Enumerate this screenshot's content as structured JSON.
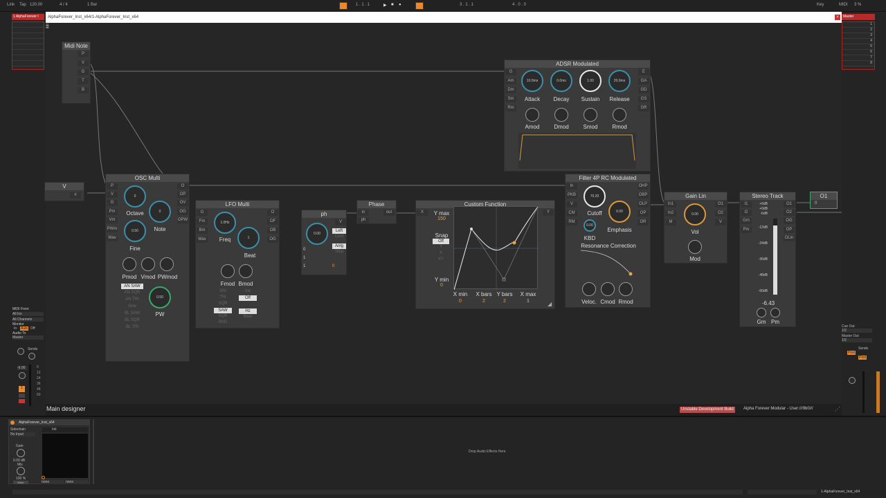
{
  "transport": {
    "link": "Link",
    "tap": "Tap",
    "tempo": "120.00",
    "signature": "4 / 4",
    "quantize": "1 Bar",
    "position": "1 . 1 . 1",
    "loop_start": "3 . 1 . 1",
    "loop_length": "4 . 0 . 0",
    "key": "Key",
    "midi": "MIDI",
    "cpu": "3 %"
  },
  "left_track": {
    "name": "1 AlphaForever I"
  },
  "right_track": {
    "name": "Master",
    "slots": [
      "1",
      "2",
      "3",
      "4",
      "5",
      "6",
      "7",
      "8"
    ]
  },
  "plugin_window": {
    "title": "AlphaForever_Inst_x64/1-AlphaForever_Inst_x64"
  },
  "modules": {
    "midi_note": {
      "title": "Midi Note",
      "outputs": [
        "P",
        "V",
        "G",
        "T",
        "B"
      ]
    },
    "v_module": {
      "title": "V",
      "out": "#"
    },
    "osc": {
      "title": "OSC Multi",
      "inputs": [
        "P",
        "V",
        "G",
        "Pm",
        "Vm",
        "PWm",
        "Wav"
      ],
      "outputs": [
        "O",
        "OP",
        "OV",
        "OG",
        "OPW"
      ],
      "octave_value": "0",
      "note_value": "0",
      "fine_value": "0.50",
      "pw_value": "0.50",
      "octave": "Octave",
      "note": "Note",
      "fine": "Fine",
      "pmod": "Pmod",
      "vmod": "Vmod",
      "pwmod": "PWmod",
      "pw": "PW",
      "waves": [
        "AN SAW",
        "AN SQR",
        "AN TRI",
        "Sine",
        "BL SAW",
        "BL SQR",
        "BL TRI"
      ]
    },
    "lfo": {
      "title": "LFO Multi",
      "inputs": [
        "G",
        "Fm",
        "Bm",
        "Wav"
      ],
      "outputs": [
        "O",
        "OF",
        "OB",
        "OG"
      ],
      "freq_value": "1.0Hz",
      "beat_value": "1",
      "freq": "Freq",
      "beat": "Beat",
      "fmod": "Fmod",
      "bmod": "Bmod",
      "waves": [
        "SIN",
        "TRI",
        "SQR",
        "SAW",
        "SQR",
        "RND"
      ],
      "inv": "Inv",
      "inv_state": "Off",
      "unit": "Hz",
      "beat_option": "Beat"
    },
    "ph": {
      "title": "ph",
      "outputs": [
        "V"
      ],
      "inputs": [
        "ph"
      ],
      "knob_value": "0.00",
      "dir": "Left",
      "dir2": "Cent",
      "mode": "Anlg",
      "mode2": "Step",
      "v0": "0",
      "v1": "1",
      "v2": "1",
      "v3": "0"
    },
    "phase": {
      "title": "Phase",
      "in": "in",
      "ph": "ph",
      "out": "out"
    },
    "custom_fn": {
      "title": "Custom Function",
      "x_port": "X",
      "y_port": "Y",
      "ymax_label": "Y max",
      "ymax": "150",
      "snap": "Snap",
      "snap_state": "Off",
      "snap_opts": [
        "Y",
        "X",
        "XY"
      ],
      "ymin_label": "Y min",
      "ymin": "0",
      "xmin_label": "X min",
      "xmin": "0",
      "xbars_label": "X bars",
      "xbars": "2",
      "ybars_label": "Y bars",
      "ybars": "2",
      "xmax_label": "X max",
      "xmax": "1"
    },
    "adsr": {
      "title": "ADSR Modulated",
      "inputs": [
        "G",
        "Am",
        "Dm",
        "Sm",
        "Rm"
      ],
      "outputs": [
        "E",
        "GA",
        "GD",
        "GS",
        "GR"
      ],
      "attack_value": "10.0ms",
      "decay_value": "0.0ms",
      "sustain_value": "1.00",
      "release_value": "20.0ms",
      "attack": "Attack",
      "decay": "Decay",
      "sustain": "Sustain",
      "release": "Release",
      "amod": "Amod",
      "dmod": "Dmod",
      "smod": "Smod",
      "rmod": "Rmod"
    },
    "filter": {
      "title": "Filter 4P RC Modulated",
      "inputs": [
        "In",
        "PKB",
        "V",
        "CM",
        "RM"
      ],
      "outputs": [
        "OHP",
        "OBP",
        "OLP",
        "OP",
        "OR"
      ],
      "cutoff_value": "70.20",
      "emphasis_value": "0.00",
      "kbd_value": "0.00",
      "cutoff": "Cutoff",
      "emphasis": "Emphasis",
      "kbd": "KBD",
      "res_corr": "Resonance Correction",
      "veloc": "Veloc.",
      "cmod": "Cmod",
      "rmod": "Rmod"
    },
    "gain": {
      "title": "Gain Lin",
      "inputs": [
        "In1",
        "In2",
        "M"
      ],
      "outputs": [
        "O1",
        "O2",
        "V"
      ],
      "vol_value": "0.00",
      "vol": "Vol",
      "mod": "Mod"
    },
    "stereo": {
      "title": "Stereo Track",
      "inputs": [
        "I1",
        "I2",
        "Gm",
        "Pm"
      ],
      "outputs": [
        "O1",
        "O2",
        "OG",
        "OP",
        "OLin"
      ],
      "scale": [
        "+6dB",
        "+0dB",
        "-6dB",
        "-12dB",
        "-24dB",
        "-36dB",
        "-48dB",
        "-60dB"
      ],
      "value": "-6.43",
      "gm": "Gm",
      "pm": "Pm"
    },
    "o1": {
      "title": "O1",
      "value": "0"
    }
  },
  "footer": {
    "label": "Main designer",
    "badge": "Unstable Development Build",
    "info": "Alpha Forever Modular - User:///9b0///"
  },
  "left_io": {
    "midi_from": "MIDI From",
    "all_ins": "All Ins",
    "all_channels": "All Channels",
    "monitor": "Monitor",
    "in": "In",
    "auto": "Auto",
    "off": "Off",
    "audio_to": "Audio To",
    "master": "Master",
    "sends": "Sends",
    "volume": "-6.00",
    "track_num": "1",
    "scale": [
      "0",
      "12",
      "24",
      "36",
      "48",
      "60"
    ]
  },
  "right_io": {
    "cue_out": "Cue Out",
    "cue_val": "1/2",
    "master_out": "Master Out",
    "master_val": "1/2",
    "sends": "Sends",
    "post": "Post"
  },
  "device": {
    "title": "AlphaForever_Inst_x64",
    "sidechain": "Sidechain",
    "no_input": "No Input",
    "preset": "Init",
    "gain": "Gain",
    "gain_value": "0.00 dB",
    "mix": "Mix",
    "mix_value": "100 %",
    "mute": "Mute",
    "none1": "none",
    "none2": "none",
    "drop": "Drop Audio Effects Here",
    "clip_name": "1-AlphaForever_Inst_x64"
  },
  "colors": {
    "accent": "#e8892f",
    "track_red": "#b52b2b",
    "knob_blue": "#3d8fa8"
  }
}
